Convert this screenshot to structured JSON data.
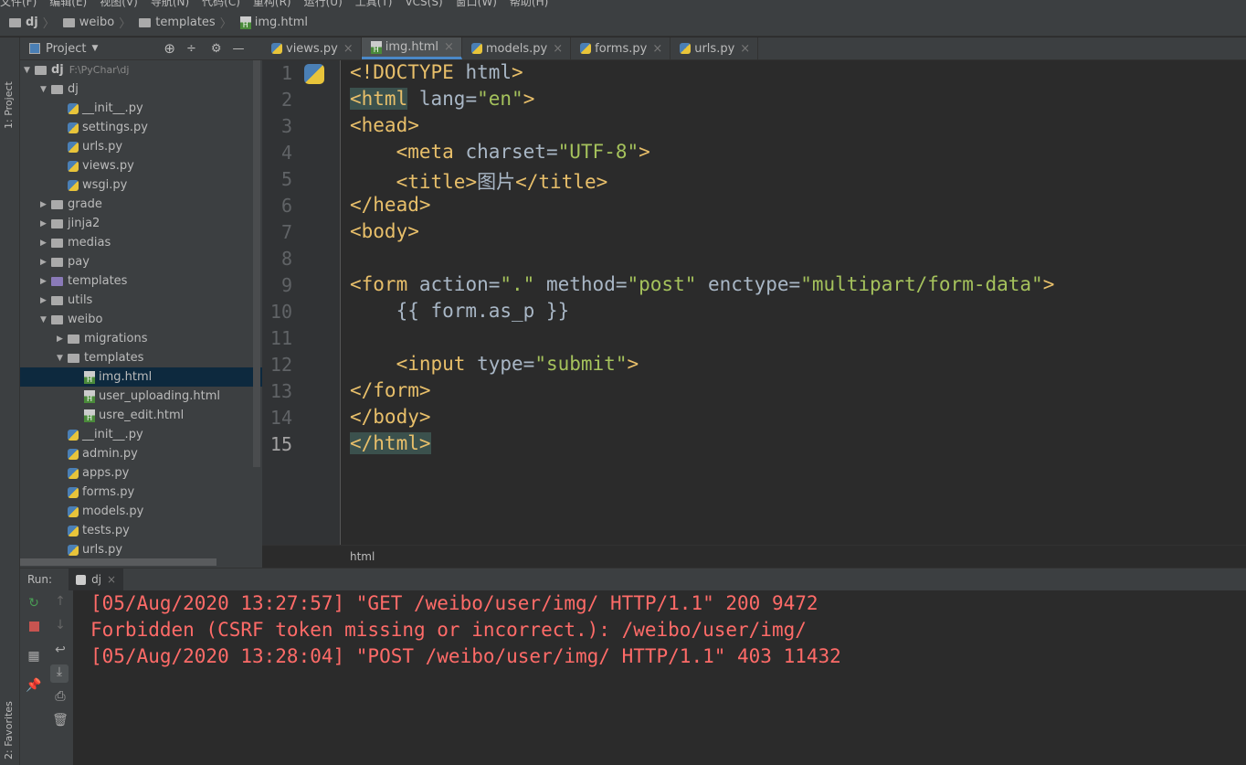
{
  "menu": [
    "文件(F)",
    "编辑(E)",
    "视图(V)",
    "导航(N)",
    "代码(C)",
    "重构(R)",
    "运行(U)",
    "工具(T)",
    "VCS(S)",
    "窗口(W)",
    "帮助(H)"
  ],
  "breadcrumb": [
    "dj",
    "weibo",
    "templates",
    "img.html"
  ],
  "side_tabs": {
    "project": "1: Project",
    "favorites": "2: Favorites"
  },
  "project": {
    "title": "Project",
    "root": "dj",
    "root_path": "F:\\PyChar\\dj",
    "tree": [
      {
        "label": "dj",
        "depth": 1,
        "type": "folder",
        "open": true
      },
      {
        "label": "__init__.py",
        "depth": 2,
        "type": "py"
      },
      {
        "label": "settings.py",
        "depth": 2,
        "type": "py"
      },
      {
        "label": "urls.py",
        "depth": 2,
        "type": "py"
      },
      {
        "label": "views.py",
        "depth": 2,
        "type": "py"
      },
      {
        "label": "wsgi.py",
        "depth": 2,
        "type": "py"
      },
      {
        "label": "grade",
        "depth": 1,
        "type": "folder"
      },
      {
        "label": "jinja2",
        "depth": 1,
        "type": "folder"
      },
      {
        "label": "medias",
        "depth": 1,
        "type": "folder"
      },
      {
        "label": "pay",
        "depth": 1,
        "type": "folder"
      },
      {
        "label": "templates",
        "depth": 1,
        "type": "folder"
      },
      {
        "label": "utils",
        "depth": 1,
        "type": "folder"
      },
      {
        "label": "weibo",
        "depth": 1,
        "type": "folder",
        "open": true
      },
      {
        "label": "migrations",
        "depth": 2,
        "type": "folder"
      },
      {
        "label": "templates",
        "depth": 2,
        "type": "folder",
        "open": true
      },
      {
        "label": "img.html",
        "depth": 3,
        "type": "html",
        "selected": true
      },
      {
        "label": "user_uploading.html",
        "depth": 3,
        "type": "html"
      },
      {
        "label": "usre_edit.html",
        "depth": 3,
        "type": "html"
      },
      {
        "label": "__init__.py",
        "depth": 2,
        "type": "py"
      },
      {
        "label": "admin.py",
        "depth": 2,
        "type": "py"
      },
      {
        "label": "apps.py",
        "depth": 2,
        "type": "py"
      },
      {
        "label": "forms.py",
        "depth": 2,
        "type": "py"
      },
      {
        "label": "models.py",
        "depth": 2,
        "type": "py"
      },
      {
        "label": "tests.py",
        "depth": 2,
        "type": "py"
      },
      {
        "label": "urls.py",
        "depth": 2,
        "type": "py"
      }
    ]
  },
  "tabs": [
    {
      "label": "views.py",
      "type": "py"
    },
    {
      "label": "img.html",
      "type": "html",
      "active": true
    },
    {
      "label": "models.py",
      "type": "py"
    },
    {
      "label": "forms.py",
      "type": "py"
    },
    {
      "label": "urls.py",
      "type": "py"
    }
  ],
  "code": [
    "<!DOCTYPE html>",
    "<html lang=\"en\">",
    "<head>",
    "    <meta charset=\"UTF-8\">",
    "    <title>图片</title>",
    "</head>",
    "<body>",
    "",
    "<form action=\".\" method=\"post\" enctype=\"multipart/form-data\">",
    "    {{ form.as_p }}",
    "",
    "    <input type=\"submit\">",
    "</form>",
    "</body>",
    "</html>"
  ],
  "status_breadcrumb": "html",
  "run": {
    "label": "Run:",
    "config": "dj",
    "output": [
      "[05/Aug/2020 13:27:57] \"GET /weibo/user/img/ HTTP/1.1\" 200 9472",
      "Forbidden (CSRF token missing or incorrect.): /weibo/user/img/",
      "[05/Aug/2020 13:28:04] \"POST /weibo/user/img/ HTTP/1.1\" 403 11432"
    ]
  },
  "colors": {
    "tag": "#e8bf6a",
    "string": "#a5c25c",
    "console": "#ff6b68",
    "selection": "#0d293e",
    "accent": "#4a88c7"
  }
}
